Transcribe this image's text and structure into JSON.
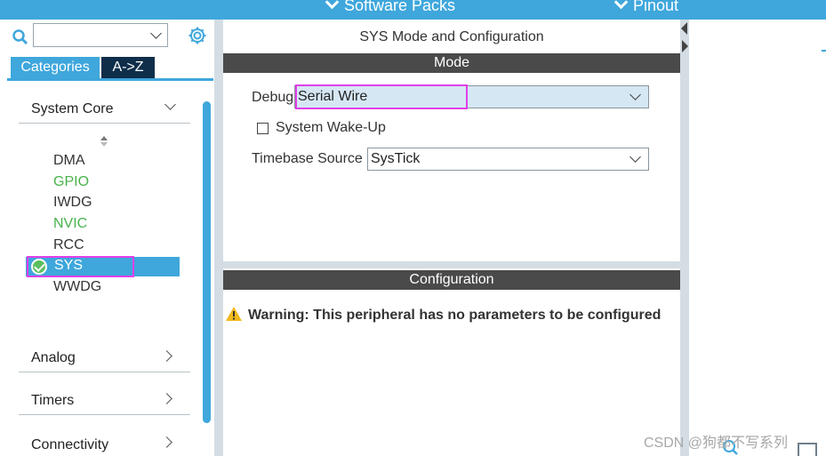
{
  "topbar": {
    "software_packs": "Software Packs",
    "pinout": "Pinout"
  },
  "left_panel": {
    "tabs": {
      "categories": "Categories",
      "a_to_z": "A->Z"
    },
    "categories": [
      {
        "label": "System Core",
        "expanded": true
      },
      {
        "label": "Analog",
        "expanded": false
      },
      {
        "label": "Timers",
        "expanded": false
      },
      {
        "label": "Connectivity",
        "expanded": false
      }
    ],
    "system_core_items": [
      {
        "label": "DMA",
        "status": "default"
      },
      {
        "label": "GPIO",
        "status": "configured"
      },
      {
        "label": "IWDG",
        "status": "default"
      },
      {
        "label": "NVIC",
        "status": "configured"
      },
      {
        "label": "RCC",
        "status": "default"
      },
      {
        "label": "SYS",
        "status": "selected"
      },
      {
        "label": "WWDG",
        "status": "default"
      }
    ]
  },
  "main": {
    "title": "SYS Mode and Configuration",
    "mode_header": "Mode",
    "debug": {
      "label": "Debug",
      "value": "Serial Wire"
    },
    "system_wakeup": {
      "label": "System Wake-Up",
      "checked": false
    },
    "timebase": {
      "label": "Timebase Source",
      "value": "SysTick"
    },
    "configuration_header": "Configuration",
    "warning": "Warning: This peripheral has no parameters to be configured"
  },
  "watermark": "CSDN @狗都不写系列",
  "colors": {
    "accent_blue": "#3fa7dc",
    "header_dark": "#4a4a4a",
    "configured_green": "#47b34b",
    "highlight_magenta": "#e040e8",
    "warning_yellow": "#f2b81d"
  }
}
